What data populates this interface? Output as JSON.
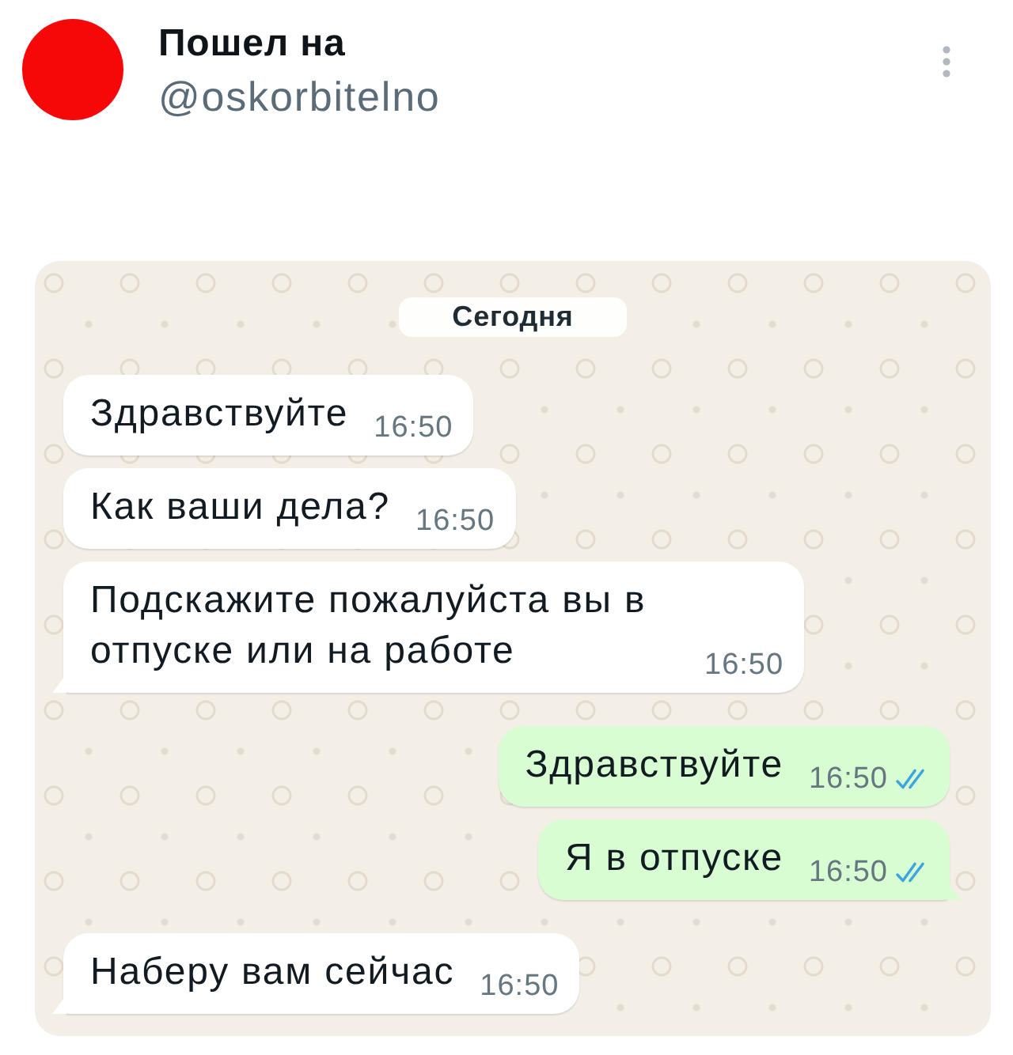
{
  "post": {
    "author_name": "Пошел на",
    "handle": "@oskorbitelno"
  },
  "chat": {
    "date_chip": "Сегодня",
    "messages": [
      {
        "kind": "incoming",
        "text": "Здравствуйте",
        "time": "16:50",
        "tail": false
      },
      {
        "kind": "incoming",
        "text": "Как ваши дела?",
        "time": "16:50",
        "tail": false
      },
      {
        "kind": "incoming",
        "text": "Подскажите пожалуйста вы в отпуске или на работе",
        "time": "16:50",
        "tail": true
      },
      {
        "kind": "outgoing",
        "text": "Здравствуйте",
        "time": "16:50",
        "tail": false,
        "read": true
      },
      {
        "kind": "outgoing",
        "text": "Я в отпуске",
        "time": "16:50",
        "tail": true,
        "read": true
      },
      {
        "kind": "incoming",
        "text": "Наберу вам сейчас",
        "time": "16:50",
        "tail": true
      }
    ]
  }
}
